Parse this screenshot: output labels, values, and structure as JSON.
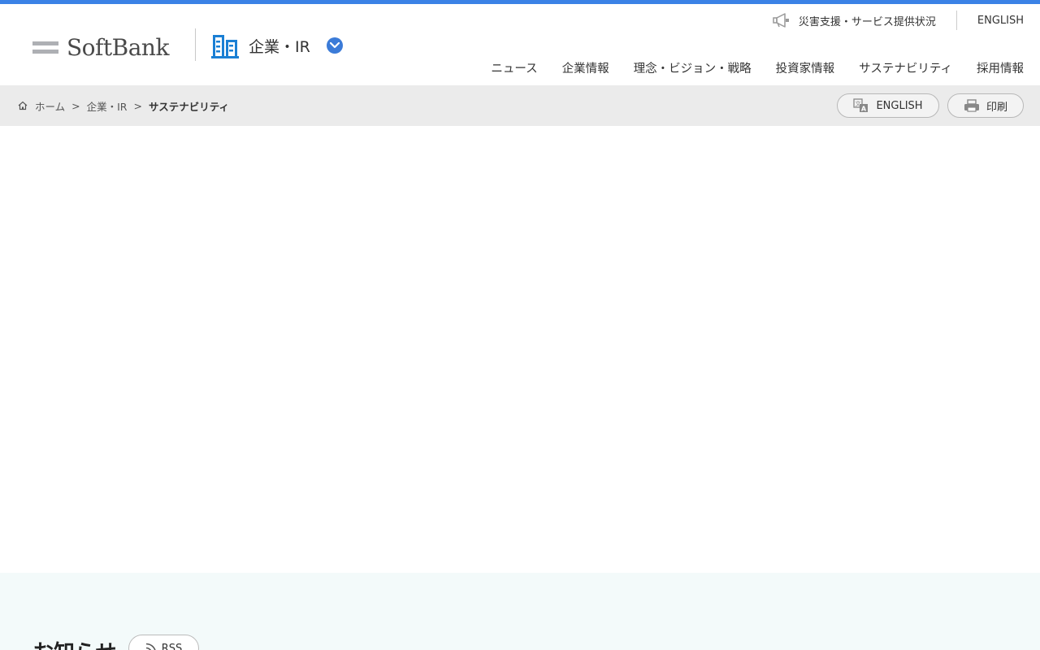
{
  "brand": {
    "logo_text": "SoftBank"
  },
  "site": {
    "name": "企業・IR"
  },
  "utility": {
    "disaster_label": "災害支援・サービス提供状況",
    "english_label": "ENGLISH"
  },
  "nav": {
    "items": [
      "ニュース",
      "企業情報",
      "理念・ビジョン・戦略",
      "投資家情報",
      "サステナビリティ",
      "採用情報"
    ]
  },
  "breadcrumb": {
    "home": "ホーム",
    "level1": "企業・IR",
    "current": "サステナビリティ",
    "separator": ">"
  },
  "actions": {
    "english_label": "ENGLISH",
    "print_label": "印刷"
  },
  "news": {
    "title": "お知らせ",
    "rss_label": "RSS"
  },
  "colors": {
    "accent": "#3b82e6",
    "site_icon": "#1a7fd4",
    "chevron": "#3b7bd8",
    "crumb_bg": "#ebebeb",
    "news_bg": "#f3fafa"
  },
  "icons": {
    "disaster": "megaphone-icon",
    "home": "home-icon",
    "english": "translate-icon",
    "print": "printer-icon",
    "rss": "rss-icon",
    "site": "building-icon",
    "menu": "chevron-down-icon"
  }
}
